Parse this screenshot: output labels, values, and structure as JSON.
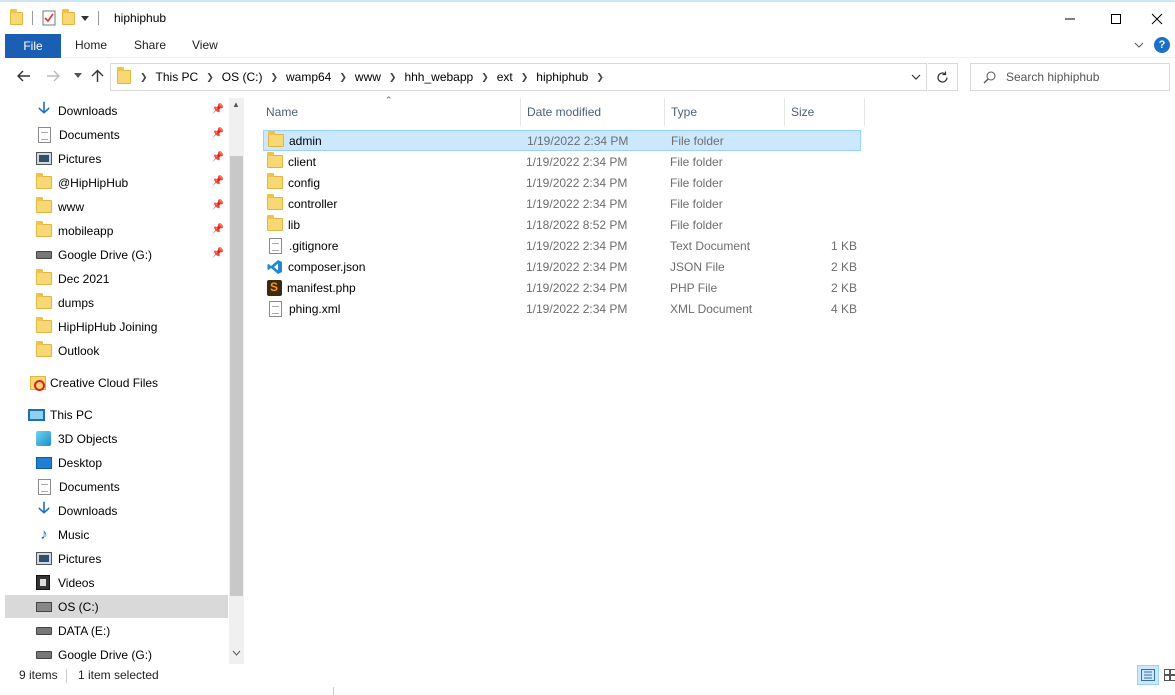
{
  "window": {
    "title": "hiphiphub"
  },
  "ribbon": {
    "tabs": [
      "File",
      "Home",
      "Share",
      "View"
    ]
  },
  "address": {
    "crumbs": [
      "This PC",
      "OS  (C:)",
      "wamp64",
      "www",
      "hhh_webapp",
      "ext",
      "hiphiphub"
    ],
    "search_placeholder": "Search hiphiphub"
  },
  "nav": {
    "quick_access": [
      {
        "label": "Downloads",
        "icon": "download-icon"
      },
      {
        "label": "Documents",
        "icon": "document-icon"
      },
      {
        "label": "Pictures",
        "icon": "pictures-icon"
      },
      {
        "label": "@HipHipHub",
        "icon": "folder-icon"
      },
      {
        "label": "www",
        "icon": "folder-icon"
      },
      {
        "label": "mobileapp",
        "icon": "folder-icon"
      },
      {
        "label": "Google Drive (G:)",
        "icon": "drive-icon"
      },
      {
        "label": "Dec 2021",
        "icon": "folder-icon"
      },
      {
        "label": "dumps",
        "icon": "folder-icon"
      },
      {
        "label": "HipHipHub Joining",
        "icon": "folder-icon"
      },
      {
        "label": "Outlook",
        "icon": "folder-icon"
      }
    ],
    "creative_cloud": "Creative Cloud Files",
    "this_pc": "This PC",
    "this_pc_items": [
      {
        "label": "3D Objects",
        "icon": "3d-objects-icon"
      },
      {
        "label": "Desktop",
        "icon": "desktop-icon"
      },
      {
        "label": "Documents",
        "icon": "document-icon"
      },
      {
        "label": "Downloads",
        "icon": "download-icon"
      },
      {
        "label": "Music",
        "icon": "music-icon"
      },
      {
        "label": "Pictures",
        "icon": "pictures-icon"
      },
      {
        "label": "Videos",
        "icon": "videos-icon"
      },
      {
        "label": "OS  (C:)",
        "icon": "os-drive-icon"
      },
      {
        "label": "DATA (E:)",
        "icon": "drive-icon"
      },
      {
        "label": "Google Drive (G:)",
        "icon": "drive-icon"
      }
    ]
  },
  "columns": {
    "name": "Name",
    "date": "Date modified",
    "type": "Type",
    "size": "Size"
  },
  "files": [
    {
      "name": "admin",
      "date": "1/19/2022 2:34 PM",
      "type": "File folder",
      "size": "",
      "icon": "folder-icon"
    },
    {
      "name": "client",
      "date": "1/19/2022 2:34 PM",
      "type": "File folder",
      "size": "",
      "icon": "folder-icon"
    },
    {
      "name": "config",
      "date": "1/19/2022 2:34 PM",
      "type": "File folder",
      "size": "",
      "icon": "folder-icon"
    },
    {
      "name": "controller",
      "date": "1/19/2022 2:34 PM",
      "type": "File folder",
      "size": "",
      "icon": "folder-icon"
    },
    {
      "name": "lib",
      "date": "1/18/2022 8:52 PM",
      "type": "File folder",
      "size": "",
      "icon": "folder-icon"
    },
    {
      "name": ".gitignore",
      "date": "1/19/2022 2:34 PM",
      "type": "Text Document",
      "size": "1 KB",
      "icon": "text-file-icon"
    },
    {
      "name": "composer.json",
      "date": "1/19/2022 2:34 PM",
      "type": "JSON File",
      "size": "2 KB",
      "icon": "vscode-file-icon"
    },
    {
      "name": "manifest.php",
      "date": "1/19/2022 2:34 PM",
      "type": "PHP File",
      "size": "2 KB",
      "icon": "sublime-file-icon"
    },
    {
      "name": "phing.xml",
      "date": "1/19/2022 2:34 PM",
      "type": "XML Document",
      "size": "4 KB",
      "icon": "xml-file-icon"
    }
  ],
  "status": {
    "items": "9 items",
    "selected": "1 item selected"
  }
}
